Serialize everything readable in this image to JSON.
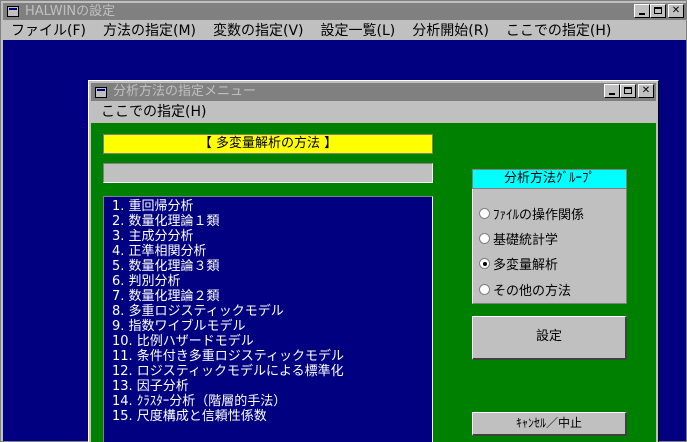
{
  "window": {
    "title": "HALWINの設定"
  },
  "menu": [
    "ファイル(F)",
    "方法の指定(M)",
    "変数の指定(V)",
    "設定一覧(L)",
    "分析開始(R)",
    "ここでの指定(H)"
  ],
  "dialog": {
    "title": "分析方法の指定メニュー",
    "menu_label": "ここでの指定(H)",
    "method_title": "【 多変量解析の方法 】",
    "methods": [
      " 1. 重回帰分析",
      " 2. 数量化理論１類",
      " 3. 主成分分析",
      " 4. 正準相関分析",
      " 5. 数量化理論３類",
      " 6. 判別分析",
      " 7. 数量化理論２類",
      " 8. 多重ロジスティックモデル",
      " 9. 指数ワイブルモデル",
      "10. 比例ハザードモデル",
      "11. 条件付き多重ロジスティックモデル",
      "12. ロジスティックモデルによる標準化",
      "13. 因子分析",
      "14. ｸﾗｽﾀｰ分析（階層的手法）",
      "15. 尺度構成と信頼性係数"
    ],
    "group_title": "分析方法ｸﾞﾙｰﾌﾟ",
    "groups": [
      {
        "label": "ﾌｧｲﾙの操作関係",
        "checked": false
      },
      {
        "label": "基礎統計学",
        "checked": false
      },
      {
        "label": "多変量解析",
        "checked": true
      },
      {
        "label": "その他の方法",
        "checked": false
      }
    ],
    "set_button": "設定",
    "cancel_button": "ｷｬﾝｾﾙ／中止"
  },
  "colors": {
    "client_bg": "#000080",
    "dialog_panel": "#008000",
    "title_highlight": "#ffff00",
    "group_header": "#00ffff"
  }
}
